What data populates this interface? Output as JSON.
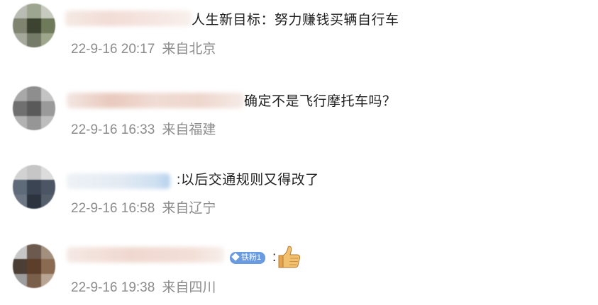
{
  "comments": [
    {
      "text": "人生新目标：努力赚钱买辆自行车",
      "date": "22-9-16 20:17",
      "location": "来自北京"
    },
    {
      "text": "确定不是飞行摩托车吗？",
      "date": "22-9-16 16:33",
      "location": "来自福建"
    },
    {
      "text": ":以后交通规则又得改了",
      "date": "22-9-16 16:58",
      "location": "来自辽宁"
    },
    {
      "text": ":",
      "badge": "铁粉1",
      "emoji": "thumbs-up-icon",
      "date": "22-9-16 19:38",
      "location": "来自四川"
    }
  ],
  "colors": {
    "text": "#1e1e1e",
    "meta": "#8c8c8c",
    "badge": "#6a9be0"
  }
}
